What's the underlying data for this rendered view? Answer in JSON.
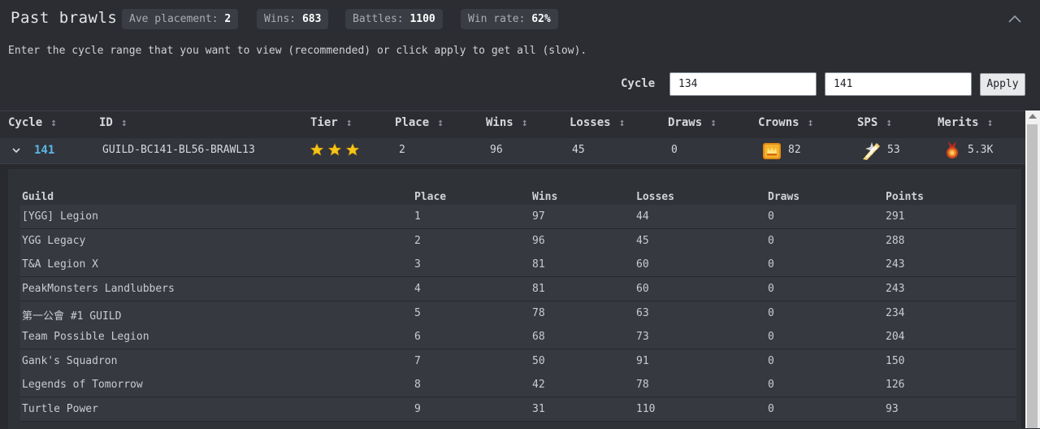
{
  "header": {
    "title": "Past brawls",
    "badges": [
      {
        "label": "Ave placement:",
        "value": "2"
      },
      {
        "label": "Wins:",
        "value": "683"
      },
      {
        "label": "Battles:",
        "value": "1100"
      },
      {
        "label": "Win rate:",
        "value": "62%"
      }
    ]
  },
  "instructions": "Enter the cycle range that you want to view (recommended) or click apply to get all (slow).",
  "range": {
    "label": "Cycle",
    "from_value": "134",
    "to_value": "141",
    "apply_label": "Apply"
  },
  "table": {
    "columns": [
      "Cycle",
      "ID",
      "Tier",
      "Place",
      "Wins",
      "Losses",
      "Draws",
      "Crowns",
      "SPS",
      "Merits"
    ],
    "row": {
      "cycle": "141",
      "id": "GUILD-BC141-BL56-BRAWL13",
      "tier_stars": 3,
      "place": "2",
      "wins": "96",
      "losses": "45",
      "draws": "0",
      "crowns": "82",
      "sps": "53",
      "merits": "5.3K",
      "icons": {
        "crowns": "crown-chest-icon",
        "sps": "sps-crystal-icon",
        "merits": "merit-medal-icon"
      }
    }
  },
  "sub_table": {
    "columns": [
      "Guild",
      "Place",
      "Wins",
      "Losses",
      "Draws",
      "Points"
    ],
    "rows": [
      [
        "[YGG] Legion",
        "1",
        "97",
        "44",
        "0",
        "291"
      ],
      [
        "YGG Legacy",
        "2",
        "96",
        "45",
        "0",
        "288"
      ],
      [
        "T&A Legion X",
        "3",
        "81",
        "60",
        "0",
        "243"
      ],
      [
        "PeakMonsters Landlubbers",
        "4",
        "81",
        "60",
        "0",
        "243"
      ],
      [
        "第一公會 #1 GUILD",
        "5",
        "78",
        "63",
        "0",
        "234"
      ],
      [
        "Team Possible Legion",
        "6",
        "68",
        "73",
        "0",
        "204"
      ],
      [
        "Gank's Squadron",
        "7",
        "50",
        "91",
        "0",
        "150"
      ],
      [
        "Legends of Tomorrow",
        "8",
        "42",
        "78",
        "0",
        "126"
      ],
      [
        "Turtle Power",
        "9",
        "31",
        "110",
        "0",
        "93"
      ]
    ]
  },
  "colors": {
    "background": "#2b2d33",
    "accent_link": "#5ab7e6",
    "star": "#f5c518"
  }
}
